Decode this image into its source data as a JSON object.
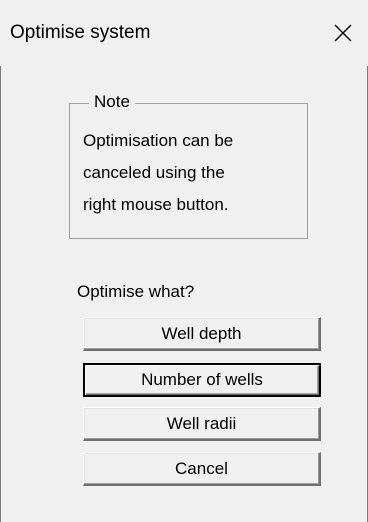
{
  "window": {
    "title": "Optimise system"
  },
  "note": {
    "legend": "Note",
    "lines": [
      "Optimisation can be",
      "canceled using the",
      "right mouse button."
    ]
  },
  "question": "Optimise what?",
  "buttons": {
    "well_depth": "Well depth",
    "number_of_wells": "Number of wells",
    "well_radii": "Well radii",
    "cancel": "Cancel"
  },
  "icons": {
    "close": "close-icon"
  }
}
